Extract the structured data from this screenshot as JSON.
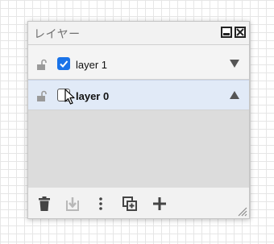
{
  "panel": {
    "title": "レイヤー"
  },
  "layers": [
    {
      "name": "layer 1",
      "visible": true,
      "locked": false,
      "selected": false,
      "arrow": "down"
    },
    {
      "name": "layer 0",
      "visible": false,
      "locked": false,
      "selected": true,
      "arrow": "up"
    }
  ],
  "toolbar": {
    "icons": [
      "trash-icon",
      "merge-down-icon",
      "more-vertical-icon",
      "duplicate-icon",
      "add-icon"
    ]
  },
  "colors": {
    "accent": "#1a73e8",
    "selected_row": "#e1eaf7",
    "empty_area": "#dcdcdc"
  }
}
